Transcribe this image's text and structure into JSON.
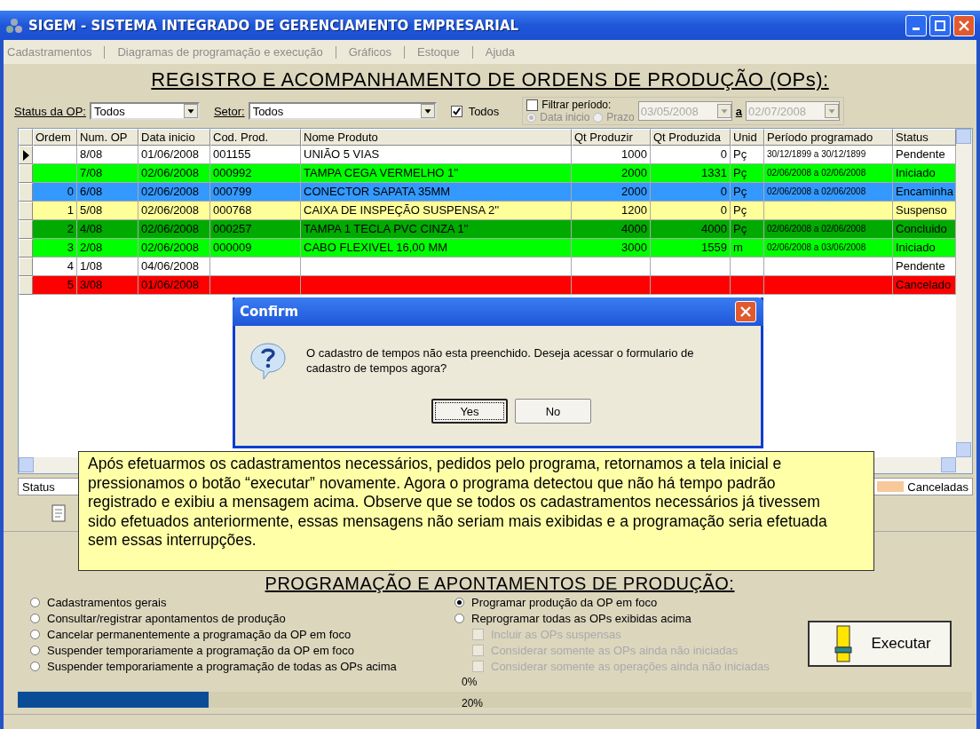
{
  "window": {
    "title": "SIGEM - SISTEMA INTEGRADO DE GERENCIAMENTO EMPRESARIAL"
  },
  "menu": [
    "Cadastramentos",
    "Diagramas de programação e execução",
    "Gráficos",
    "Estoque",
    "Ajuda"
  ],
  "heading": "REGISTRO E ACOMPANHAMENTO DE ORDENS DE PRODUÇÃO (OPs):",
  "filters": {
    "status_label": "Status da OP:",
    "status_value": "Todos",
    "sector_label": "Setor:",
    "sector_value": "Todos",
    "all_checkbox": {
      "label": "Todos",
      "checked": true
    },
    "period": {
      "label": "Filtrar período:",
      "checked": false,
      "disabled": true,
      "options": [
        {
          "label": "Data inicio",
          "selected": true
        },
        {
          "label": "Prazo",
          "selected": false
        }
      ],
      "from": "03/05/2008",
      "separator": "a",
      "to": "02/07/2008"
    }
  },
  "table": {
    "columns": [
      "Ordem",
      "Num. OP",
      "Data inicio",
      "Cod. Prod.",
      "Nome Produto",
      "Qt Produzir",
      "Qt Produzida",
      "Unid",
      "Período programado",
      "Status"
    ],
    "rows": [
      {
        "current": true,
        "color": "#ffffff",
        "cells": [
          "",
          "8/08",
          "01/06/2008",
          "001155",
          "UNIÃO 5 VIAS",
          "1000",
          "0",
          "Pç",
          "30/12/1899 a 30/12/1899",
          "Pendente"
        ]
      },
      {
        "current": false,
        "color": "#00ff00",
        "cells": [
          "",
          "7/08",
          "02/06/2008",
          "000992",
          "TAMPA CEGA VERMELHO 1''",
          "2000",
          "1331",
          "Pç",
          "02/06/2008 a 02/06/2008",
          "Iniciado"
        ]
      },
      {
        "current": false,
        "color": "#3399ff",
        "cells": [
          "0",
          "6/08",
          "02/06/2008",
          "000799",
          "CONECTOR SAPATA 35MM",
          "2000",
          "0",
          "Pç",
          "02/06/2008 a 02/06/2008",
          "Encaminha"
        ]
      },
      {
        "current": false,
        "color": "#ffff99",
        "cells": [
          "1",
          "5/08",
          "02/06/2008",
          "000768",
          "CAIXA DE INSPEÇÃO SUSPENSA  2''",
          "1200",
          "0",
          "Pç",
          "",
          "Suspenso"
        ]
      },
      {
        "current": false,
        "color": "#00aa00",
        "cells": [
          "2",
          "4/08",
          "02/06/2008",
          "000257",
          "TAMPA 1 TECLA PVC  CINZA 1''",
          "4000",
          "4000",
          "Pç",
          "02/06/2008 a 02/06/2008",
          "Concluido"
        ]
      },
      {
        "current": false,
        "color": "#00ff00",
        "cells": [
          "3",
          "2/08",
          "02/06/2008",
          "000009",
          "CABO FLEXIVEL 16,00  MM",
          "3000",
          "1559",
          "m",
          "02/06/2008 a 03/06/2008",
          "Iniciado"
        ]
      },
      {
        "current": false,
        "color": "#ffffff",
        "cells": [
          "4",
          "1/08",
          "04/06/2008",
          "",
          "",
          "",
          "",
          "",
          "",
          "Pendente"
        ]
      },
      {
        "current": false,
        "color": "#ff0000",
        "cells": [
          "5",
          "3/08",
          "01/06/2008",
          "",
          "",
          "",
          "",
          "",
          "",
          "Cancelado"
        ]
      }
    ]
  },
  "legend": {
    "title": "Status",
    "items": [
      {
        "label": "Canceladas",
        "color": "#f7c89a"
      }
    ]
  },
  "section2": {
    "heading": "PROGRAMAÇÃO E APONTAMENTOS DE PRODUÇÃO:",
    "left_options": [
      {
        "label": "Cadastramentos gerais",
        "selected": false
      },
      {
        "label": "Consultar/registrar apontamentos de produção",
        "selected": false
      },
      {
        "label": "Cancelar permanentemente a programação da OP em foco",
        "selected": false
      },
      {
        "label": "Suspender temporariamente a programação da OP em foco",
        "selected": false
      },
      {
        "label": "Suspender temporariamente a programação de todas as OPs acima",
        "selected": false
      }
    ],
    "right_options": [
      {
        "label": "Programar produção da OP em foco",
        "selected": true
      },
      {
        "label": "Reprogramar todas as OPs exibidas acima",
        "selected": false
      }
    ],
    "sub_options": [
      {
        "label": "Incluir as OPs suspensas",
        "checked": false,
        "disabled": true
      },
      {
        "label": "Considerar somente as OPs ainda não iniciadas",
        "checked": false,
        "disabled": true
      },
      {
        "label": "Considerar somente as operações ainda não iniciadas",
        "checked": false,
        "disabled": true
      }
    ],
    "execute_button": "Executar",
    "progress": {
      "top_label": "0%",
      "level": 0.2,
      "label": "20%"
    }
  },
  "dialog": {
    "title": "Confirm",
    "message": "O cadastro de tempos não esta preenchido. Deseja acessar o formulario de cadastro de tempos agora?",
    "buttons": [
      {
        "label": "Yes",
        "default": true
      },
      {
        "label": "No",
        "default": false
      }
    ]
  },
  "note": "Após efetuarmos os cadastramentos necessários, pedidos pelo programa, retornamos a tela inicial e pressionamos o botão “executar” novamente. Agora o programa detectou que não há tempo padrão registrado e exibiu a mensagem acima. Observe que se todos os cadastramentos necessários já tivessem sido efetuados anteriormente, essas mensagens não seriam mais exibidas e a programação seria efetuada sem essas interrupções."
}
